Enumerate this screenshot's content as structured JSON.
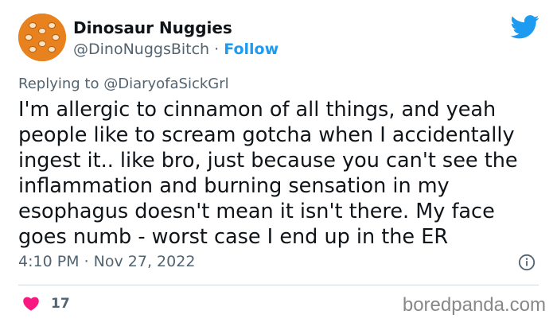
{
  "author": {
    "display_name": "Dinosaur Nuggies",
    "handle": "@DinoNuggsBitch",
    "separator": "·",
    "follow_label": "Follow",
    "avatar_icon": "dino-nuggets-avatar-icon"
  },
  "platform_icon": "twitter-bird-icon",
  "reply": {
    "prefix": "Replying to",
    "mention": "@DiaryofaSickGrl"
  },
  "tweet": {
    "lines": [
      "I'm allergic to cinnamon of all things, and yeah",
      "people like to scream gotcha when I accidentally",
      "ingest it.. like bro, just because you can't see the",
      "inflammation and burning sensation in my",
      "esophagus doesn't mean it isn't there. My face",
      "goes numb - worst case I end up in the ER"
    ]
  },
  "timestamp": "4:10 PM · Nov 27, 2022",
  "likes": {
    "count": "17",
    "icon": "heart-icon"
  },
  "watermark": "boredpanda.com",
  "colors": {
    "accent": "#1d9bf0",
    "like": "#f91880",
    "muted": "#536471",
    "avatar": "#e8821f"
  }
}
